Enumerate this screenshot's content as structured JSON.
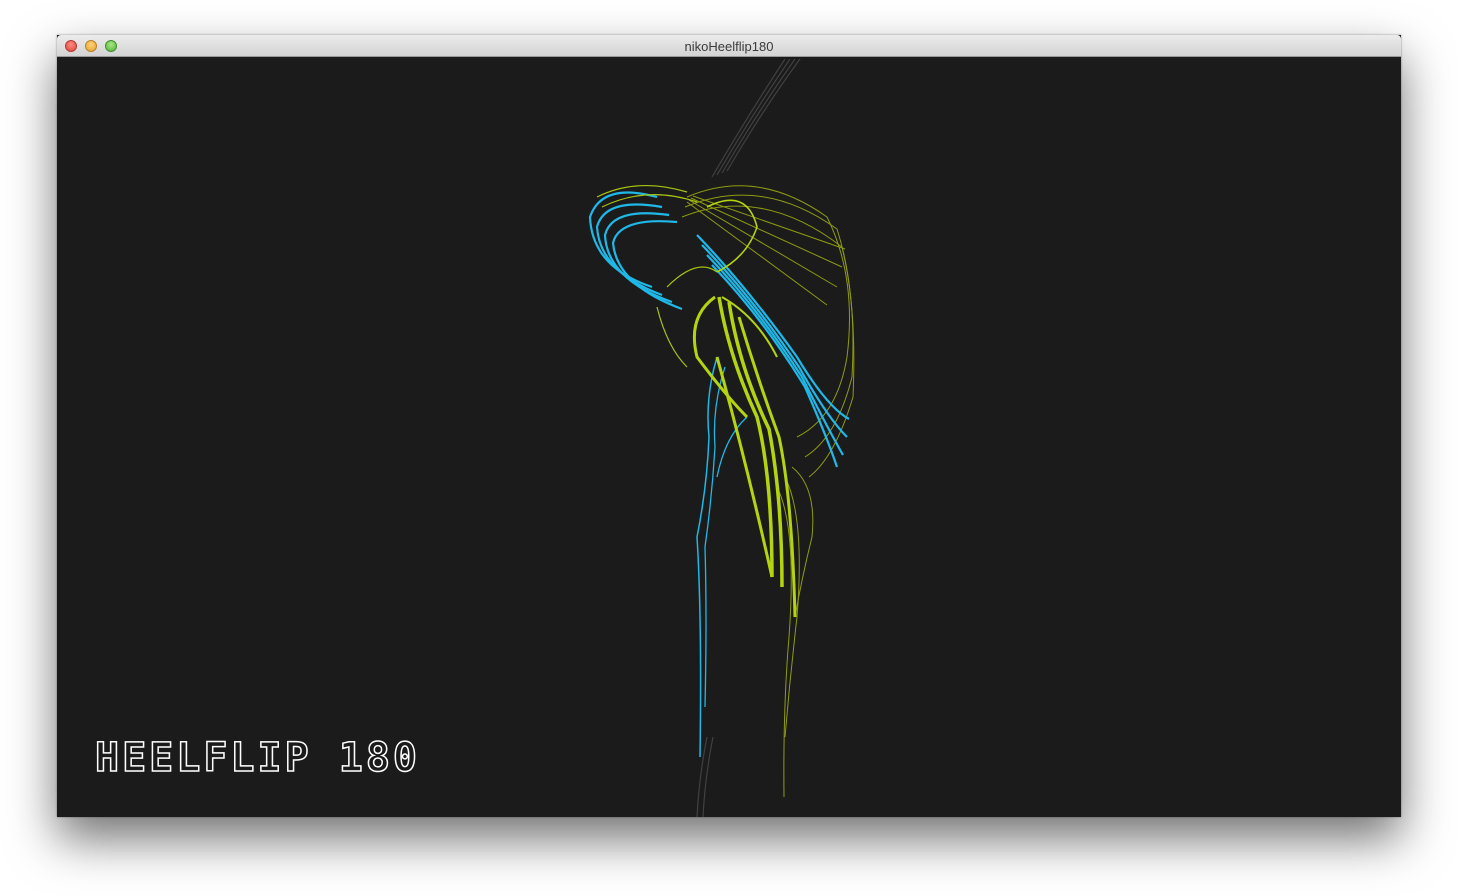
{
  "window": {
    "title": "nikoHeelflip180",
    "buttons": [
      "close",
      "minimize",
      "maximize"
    ]
  },
  "canvas": {
    "background": "#1b1b1b",
    "overlay_text": "HEELFLIP 180",
    "colors": {
      "cyan": "#1fb8e8",
      "lime": "#b5d410",
      "olive": "#8f9c12",
      "grey": "#4a4a4a"
    }
  }
}
